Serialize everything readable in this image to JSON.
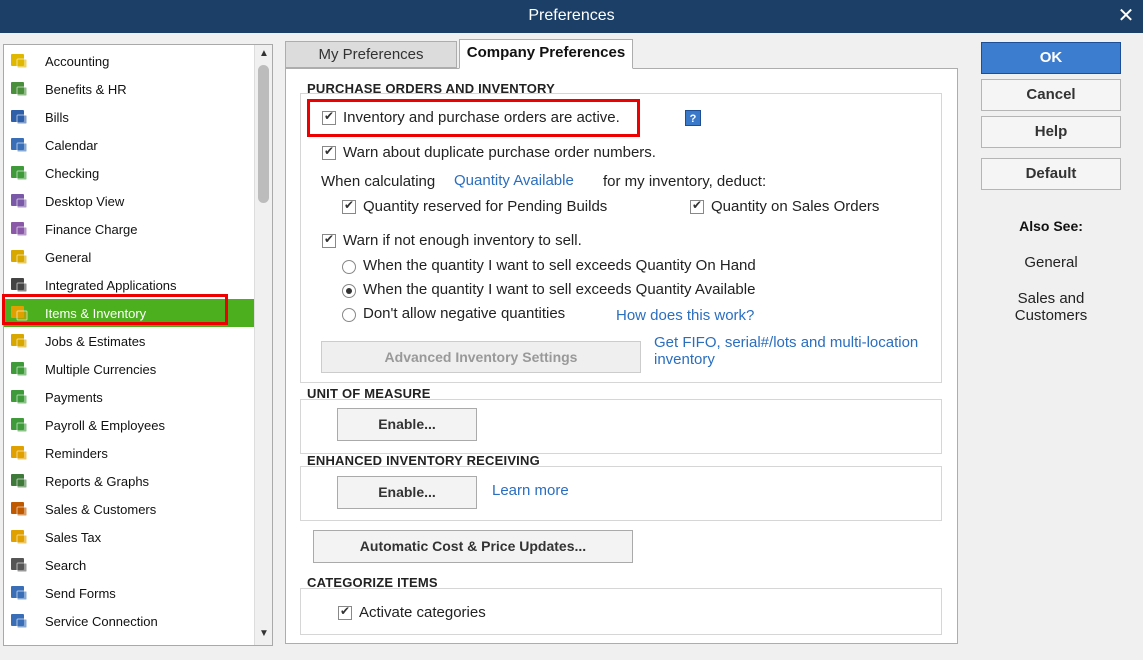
{
  "window": {
    "title": "Preferences"
  },
  "sidebar": {
    "items": [
      {
        "label": "Accounting",
        "icon": "accounting-icon",
        "color": "#e0b800"
      },
      {
        "label": "Benefits & HR",
        "icon": "benefits-hr-icon",
        "color": "#4a8f3c"
      },
      {
        "label": "Bills",
        "icon": "bills-icon",
        "color": "#2f5fa8"
      },
      {
        "label": "Calendar",
        "icon": "calendar-icon",
        "color": "#3a6fb8"
      },
      {
        "label": "Checking",
        "icon": "checking-icon",
        "color": "#3f9a3a"
      },
      {
        "label": "Desktop View",
        "icon": "desktop-view-icon",
        "color": "#7a5aa8"
      },
      {
        "label": "Finance Charge",
        "icon": "finance-charge-icon",
        "color": "#8a5aa8"
      },
      {
        "label": "General",
        "icon": "general-icon",
        "color": "#d9a800"
      },
      {
        "label": "Integrated Applications",
        "icon": "integrated-apps-icon",
        "color": "#444444"
      },
      {
        "label": "Items & Inventory",
        "icon": "items-inventory-icon",
        "color": "#e0a000"
      },
      {
        "label": "Jobs & Estimates",
        "icon": "jobs-estimates-icon",
        "color": "#d9a800"
      },
      {
        "label": "Multiple Currencies",
        "icon": "multiple-currencies-icon",
        "color": "#3f9a3a"
      },
      {
        "label": "Payments",
        "icon": "payments-icon",
        "color": "#3f9a3a"
      },
      {
        "label": "Payroll & Employees",
        "icon": "payroll-employees-icon",
        "color": "#3f9a3a"
      },
      {
        "label": "Reminders",
        "icon": "reminders-icon",
        "color": "#e0a000"
      },
      {
        "label": "Reports & Graphs",
        "icon": "reports-graphs-icon",
        "color": "#3f7a3a"
      },
      {
        "label": "Sales & Customers",
        "icon": "sales-customers-icon",
        "color": "#c05a00"
      },
      {
        "label": "Sales Tax",
        "icon": "sales-tax-icon",
        "color": "#e0a000"
      },
      {
        "label": "Search",
        "icon": "search-icon",
        "color": "#555555"
      },
      {
        "label": "Send Forms",
        "icon": "send-forms-icon",
        "color": "#3a6fb8"
      },
      {
        "label": "Service Connection",
        "icon": "service-connection-icon",
        "color": "#3a6fb8"
      }
    ],
    "selected": "Items & Inventory"
  },
  "tabs": {
    "my_prefs": "My Preferences",
    "company_prefs": "Company Preferences"
  },
  "po_section": {
    "title": "PURCHASE ORDERS AND INVENTORY",
    "inventory_active": "Inventory and purchase orders are active.",
    "help_glyph": "?",
    "warn_duplicate": "Warn about duplicate purchase order numbers.",
    "when_calculating": "When calculating",
    "quantity_available_link": "Quantity Available",
    "for_my_inventory": "for my inventory, deduct:",
    "qty_reserved": "Quantity reserved for Pending Builds",
    "qty_sales_orders": "Quantity on Sales Orders",
    "warn_not_enough": "Warn if not enough inventory to sell.",
    "radio_on_hand": "When the quantity I want to sell exceeds Quantity On Hand",
    "radio_available": "When the quantity I want to sell exceeds Quantity Available",
    "radio_dont_allow": "Don't allow negative quantities",
    "how_works_link": "How does this work?",
    "advanced_btn": "Advanced Inventory Settings",
    "fifo_link_line1": "Get FIFO, serial#/lots and multi-location",
    "fifo_link_line2": "inventory"
  },
  "uom_section": {
    "title": "UNIT OF MEASURE",
    "enable_btn": "Enable..."
  },
  "receiving_section": {
    "title": "ENHANCED INVENTORY RECEIVING",
    "enable_btn": "Enable...",
    "learn_more": "Learn more"
  },
  "auto_cost_btn": "Automatic Cost & Price Updates...",
  "categorize_section": {
    "title": "CATEGORIZE ITEMS",
    "activate": "Activate categories"
  },
  "right": {
    "ok": "OK",
    "cancel": "Cancel",
    "help": "Help",
    "default": "Default",
    "also_see": "Also See:",
    "general": "General",
    "sales_customers_line1": "Sales and",
    "sales_customers_line2": "Customers"
  },
  "colors": {
    "titlebar": "#1c3f67",
    "selected": "#4caf1e",
    "highlight": "#e00000",
    "link": "#2a6ebf",
    "ok": "#3d7dd0"
  }
}
